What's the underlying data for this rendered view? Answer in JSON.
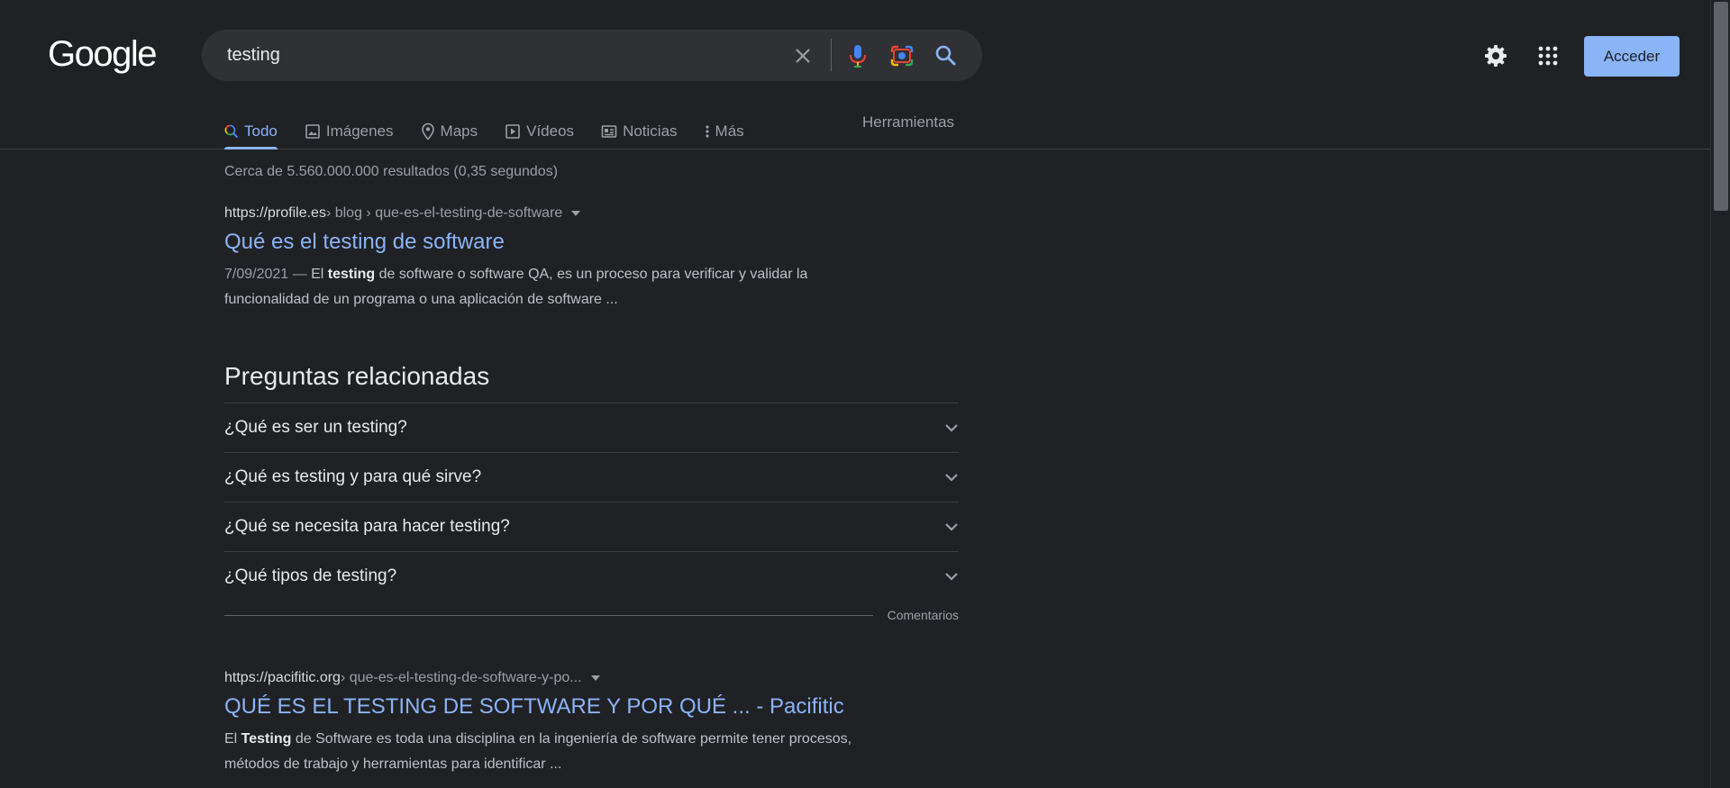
{
  "header": {
    "logo": "Google",
    "search": {
      "value": "testing",
      "placeholder": ""
    },
    "signin_label": "Acceder"
  },
  "tabs": [
    {
      "label": "Todo",
      "icon": "search-icon"
    },
    {
      "label": "Imágenes",
      "icon": "image-icon"
    },
    {
      "label": "Maps",
      "icon": "map-pin-icon"
    },
    {
      "label": "Vídeos",
      "icon": "play-icon"
    },
    {
      "label": "Noticias",
      "icon": "news-icon"
    },
    {
      "label": "Más",
      "icon": "more-vert-icon"
    }
  ],
  "tools_label": "Herramientas",
  "result_stats": "Cerca de 5.560.000.000 resultados (0,35 segundos)",
  "results": [
    {
      "domain": "https://profile.es",
      "path": " › blog › que-es-el-testing-de-software",
      "title": "Qué es el testing de software",
      "date": "7/09/2021 — ",
      "snippet_pre": "El ",
      "snippet_bold": "testing",
      "snippet_post": " de software o software QA, es un proceso para verificar y validar la funcionalidad de un programa o una aplicación de software ..."
    },
    {
      "domain": "https://pacifitic.org",
      "path": " › que-es-el-testing-de-software-y-po...",
      "title": "QUÉ ES EL TESTING DE SOFTWARE Y POR QUÉ ... - Pacifitic",
      "snippet_pre": "El ",
      "snippet_bold": "Testing",
      "snippet_post": " de Software es toda una disciplina en la ingeniería de software permite tener procesos, métodos de trabajo y herramientas para identificar ..."
    }
  ],
  "paa": {
    "title": "Preguntas relacionadas",
    "questions": [
      "¿Qué es ser un testing?",
      "¿Qué es testing y para qué sirve?",
      "¿Qué se necesita para hacer testing?",
      "¿Qué tipos de testing?"
    ],
    "feedback_label": "Comentarios"
  },
  "colors": {
    "background": "#202124",
    "link": "#8ab4f8",
    "accent_button": "#8ab4f8"
  }
}
